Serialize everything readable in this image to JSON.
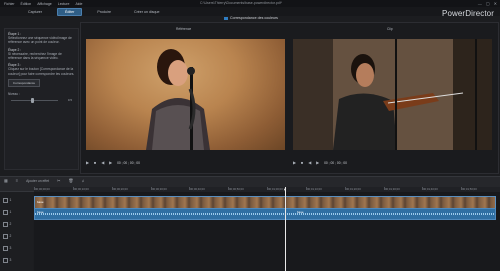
{
  "window": {
    "menu": [
      "Fichier",
      "Édition",
      "Affichage",
      "Lecture",
      "Aide"
    ],
    "path": "C:\\Users\\Thierry\\Documents\\base-powerdirector.pdl*",
    "controls": [
      "—",
      "▢",
      "✕"
    ],
    "brand": "PowerDirector"
  },
  "modules": [
    "Capturer",
    "Éditer",
    "Produire",
    "Créer un disque"
  ],
  "editor": {
    "title": "Correspondance des couleurs",
    "left_label": "Référence",
    "right_label": "Clip",
    "left_time": "00 ; 00 ; 00 ; 00",
    "right_time": "00 ; 00 ; 00 ; 00"
  },
  "steps": [
    {
      "title": "Étape 1 :",
      "body": "Sélectionnez une séquence vidéo/image de référence avec un point de couleur."
    },
    {
      "title": "Étape 2 :",
      "body": "Si nécessaire, recherchez l'image de référence dans la séquence vidéo."
    },
    {
      "title": "Étape 3 :",
      "body": "Cliquez sur le bouton [Correspondance de la couleur] pour faire correspondre les couleurs."
    }
  ],
  "match_button": "Correspondance",
  "strength": {
    "label": "Niveau :",
    "value": "0.5",
    "fraction": 0.4
  },
  "timeline": {
    "toolbar_label": "Ajouter un effet",
    "ruler": [
      "00;00;00;00",
      "00;00;10;00",
      "00;00;20;00",
      "00;00;30;00",
      "00;00;40;00",
      "00;00;50;00",
      "00;01;00;00",
      "00;01;10;00",
      "00;01;20;00",
      "00;01;30;00",
      "00;01;40;00",
      "00;01;50;00"
    ],
    "tracks": [
      "1",
      "1",
      "2",
      "2",
      "3",
      "3"
    ],
    "video_clip": "base",
    "audio_clip": "base",
    "audio_clip2": "base"
  }
}
